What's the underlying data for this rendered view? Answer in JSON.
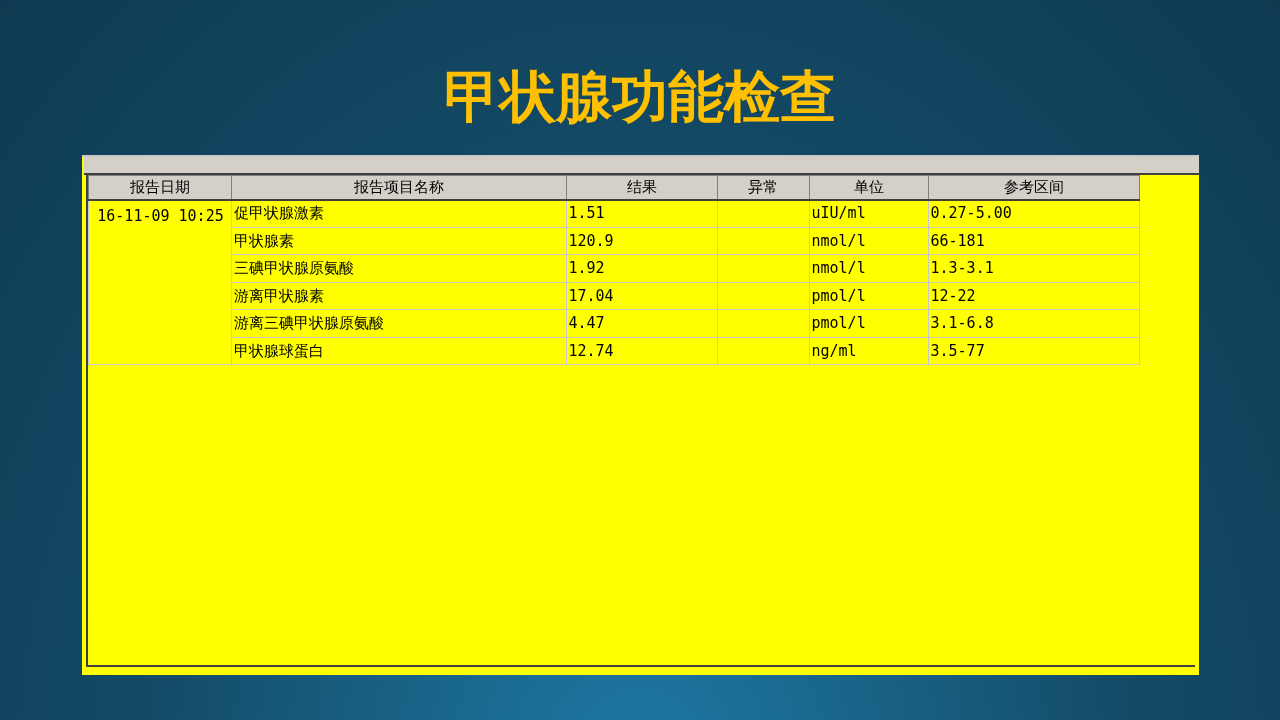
{
  "slide_title": "甲状腺功能检查",
  "table": {
    "columns": [
      "报告日期",
      "报告项目名称",
      "结果",
      "异常",
      "单位",
      "参考区间"
    ],
    "reports": [
      {
        "date": "16-11-09 10:25",
        "items": [
          {
            "name": "促甲状腺激素",
            "result": "1.51",
            "unit": "uIU/ml",
            "range": "0.27-5.00"
          },
          {
            "name": "甲状腺素",
            "result": "120.9",
            "unit": "nmol/l",
            "range": "66-181"
          },
          {
            "name": "三碘甲状腺原氨酸",
            "result": "1.92",
            "unit": "nmol/l",
            "range": "1.3-3.1"
          },
          {
            "name": "游离甲状腺素",
            "result": "17.04",
            "unit": "pmol/l",
            "range": "12-22"
          },
          {
            "name": "游离三碘甲状腺原氨酸",
            "result": "4.47",
            "unit": "pmol/l",
            "range": "3.1-6.8"
          },
          {
            "name": "甲状腺球蛋白",
            "result": "12.74",
            "unit": "ng/ml",
            "range": "3.5-77"
          }
        ]
      }
    ]
  }
}
